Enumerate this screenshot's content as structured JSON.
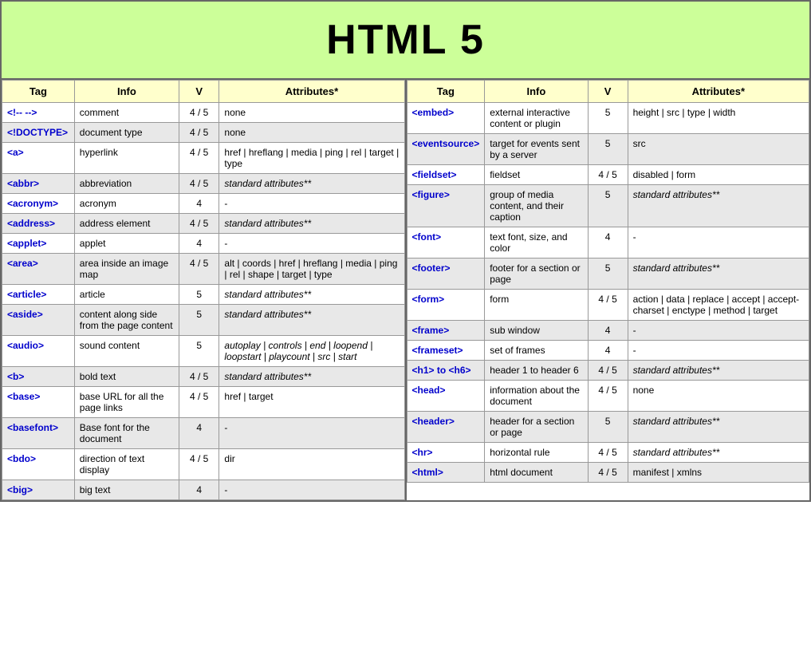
{
  "header": {
    "title": "HTML 5"
  },
  "left_table": {
    "columns": [
      "Tag",
      "Info",
      "V",
      "Attributes*"
    ],
    "rows": [
      {
        "tag": "<!-- -->",
        "info": "comment",
        "v": "4 / 5",
        "attr": "none",
        "italic": false,
        "gray": false
      },
      {
        "tag": "<!DOCTYPE>",
        "info": "document type",
        "v": "4 / 5",
        "attr": "none",
        "italic": false,
        "gray": true
      },
      {
        "tag": "<a>",
        "info": "hyperlink",
        "v": "4 / 5",
        "attr": "href | hreflang | media | ping | rel | target | type",
        "italic": false,
        "gray": false
      },
      {
        "tag": "<abbr>",
        "info": "abbreviation",
        "v": "4 / 5",
        "attr": "standard attributes**",
        "italic": true,
        "gray": true
      },
      {
        "tag": "<acronym>",
        "info": "acronym",
        "v": "4",
        "attr": "-",
        "italic": false,
        "gray": false
      },
      {
        "tag": "<address>",
        "info": "address element",
        "v": "4 / 5",
        "attr": "standard attributes**",
        "italic": true,
        "gray": true
      },
      {
        "tag": "<applet>",
        "info": "applet",
        "v": "4",
        "attr": "-",
        "italic": false,
        "gray": false
      },
      {
        "tag": "<area>",
        "info": "area inside an image map",
        "v": "4 / 5",
        "attr": "alt | coords | href | hreflang | media | ping | rel | shape | target | type",
        "italic": false,
        "gray": true
      },
      {
        "tag": "<article>",
        "info": "article",
        "v": "5",
        "attr": "standard attributes**",
        "italic": true,
        "gray": false
      },
      {
        "tag": "<aside>",
        "info": "content along side from the page content",
        "v": "5",
        "attr": "standard attributes**",
        "italic": true,
        "gray": true
      },
      {
        "tag": "<audio>",
        "info": "sound content",
        "v": "5",
        "attr": "autoplay | controls | end | loopend | loopstart | playcount | src | start",
        "italic": true,
        "gray": false
      },
      {
        "tag": "<b>",
        "info": "bold text",
        "v": "4 / 5",
        "attr": "standard attributes**",
        "italic": true,
        "gray": true
      },
      {
        "tag": "<base>",
        "info": "base URL for all the page links",
        "v": "4 / 5",
        "attr": "href | target",
        "italic": false,
        "gray": false
      },
      {
        "tag": "<basefont>",
        "info": "Base font for the document",
        "v": "4",
        "attr": "-",
        "italic": false,
        "gray": true
      },
      {
        "tag": "<bdo>",
        "info": "direction of text display",
        "v": "4 / 5",
        "attr": "dir",
        "italic": false,
        "gray": false
      },
      {
        "tag": "<big>",
        "info": "big text",
        "v": "4",
        "attr": "-",
        "italic": false,
        "gray": true
      }
    ]
  },
  "right_table": {
    "columns": [
      "Tag",
      "Info",
      "V",
      "Attributes*"
    ],
    "rows": [
      {
        "tag": "<embed>",
        "info": "external interactive content or plugin",
        "v": "5",
        "attr": "height | src | type | width",
        "italic": false,
        "gray": false
      },
      {
        "tag": "<eventsource>",
        "info": "target for events sent by a server",
        "v": "5",
        "attr": "src",
        "italic": false,
        "gray": true
      },
      {
        "tag": "<fieldset>",
        "info": "fieldset",
        "v": "4 / 5",
        "attr": "disabled | form",
        "italic": false,
        "gray": false
      },
      {
        "tag": "<figure>",
        "info": "group of media content, and their caption",
        "v": "5",
        "attr": "standard attributes**",
        "italic": true,
        "gray": true
      },
      {
        "tag": "<font>",
        "info": "text font, size, and color",
        "v": "4",
        "attr": "-",
        "italic": false,
        "gray": false
      },
      {
        "tag": "<footer>",
        "info": "footer for a section or page",
        "v": "5",
        "attr": "standard attributes**",
        "italic": true,
        "gray": true
      },
      {
        "tag": "<form>",
        "info": "form",
        "v": "4 / 5",
        "attr": "action | data | replace | accept | accept-charset | enctype | method | target",
        "italic": false,
        "gray": false
      },
      {
        "tag": "<frame>",
        "info": "sub window",
        "v": "4",
        "attr": "-",
        "italic": false,
        "gray": true
      },
      {
        "tag": "<frameset>",
        "info": "set of frames",
        "v": "4",
        "attr": "-",
        "italic": false,
        "gray": false
      },
      {
        "tag": "<h1> to <h6>",
        "info": "header 1 to header 6",
        "v": "4 / 5",
        "attr": "standard attributes**",
        "italic": true,
        "gray": true
      },
      {
        "tag": "<head>",
        "info": "information about the document",
        "v": "4 / 5",
        "attr": "none",
        "italic": false,
        "gray": false
      },
      {
        "tag": "<header>",
        "info": "header for a section or page",
        "v": "5",
        "attr": "standard attributes**",
        "italic": true,
        "gray": true
      },
      {
        "tag": "<hr>",
        "info": "horizontal rule",
        "v": "4 / 5",
        "attr": "standard attributes**",
        "italic": true,
        "gray": false
      },
      {
        "tag": "<html>",
        "info": "html document",
        "v": "4 / 5",
        "attr": "manifest | xmlns",
        "italic": false,
        "gray": true
      }
    ]
  }
}
